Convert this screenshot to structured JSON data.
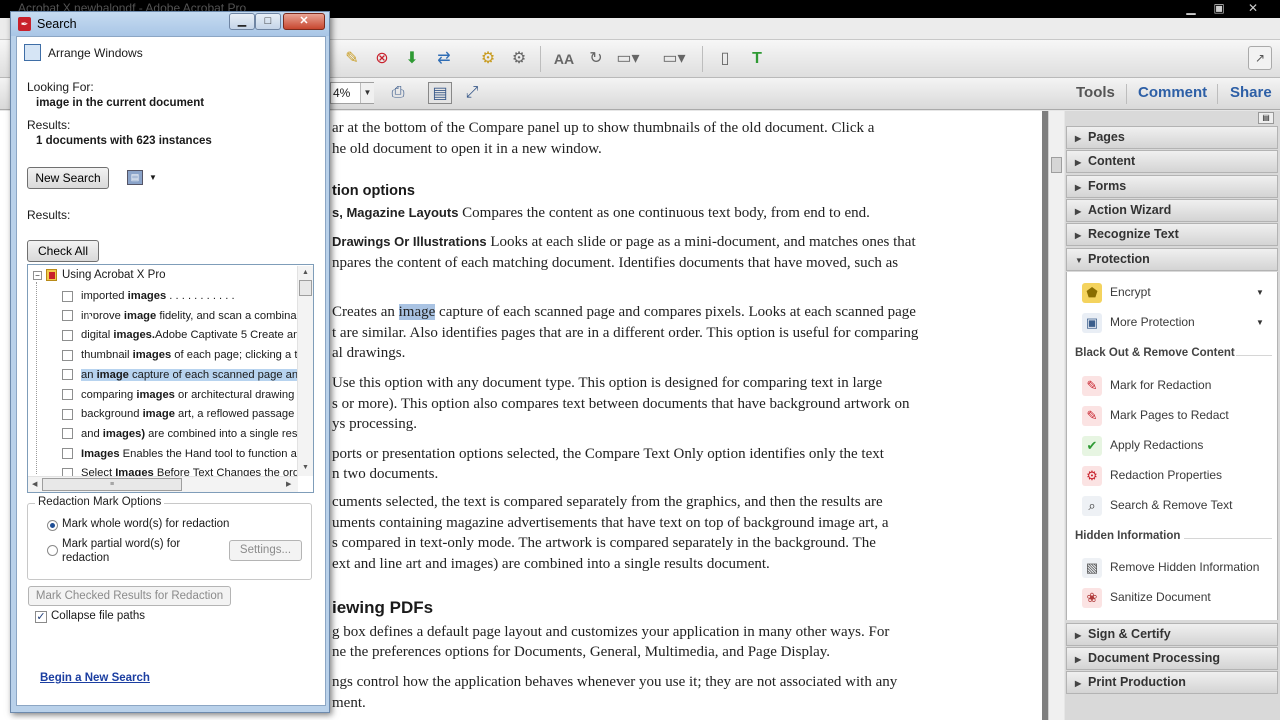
{
  "app": {
    "title": "Acrobat X newbalondf - Adobe Acrobat Pro",
    "zoom_value": "4%",
    "pane_tabs": [
      "Tools",
      "Comment",
      "Share"
    ]
  },
  "toolbar_icons": [
    "edit-icon",
    "delete-page-icon",
    "insert-page-icon",
    "extract-page-icon",
    "replace-page-icon",
    "settings-icon",
    "typeface-icon",
    "rotate-icon",
    "form-icon",
    "layout-icon",
    "page-icon",
    "text-icon"
  ],
  "document": {
    "lines": [
      {
        "text": "ar at the bottom of the Compare panel up to show thumbnails of the old document. Click a"
      },
      {
        "text": "he old document to open it in a new window."
      },
      {
        "heading": "tion options"
      },
      {
        "bold": "s, Magazine Layouts",
        "text": "  Compares the content as one continuous text body, from end to end."
      },
      {
        "bold": "Drawings Or Illustrations",
        "text": "  Looks at each slide or page as a mini-document, and matches ones that"
      },
      {
        "text": "npares the content of each matching document. Identifies documents that have moved, such as"
      },
      {
        "pre": "Creates an ",
        "hl": "image",
        "post": " capture of each scanned page and compares pixels. Looks at each scanned page"
      },
      {
        "text": "t are similar. Also identifies pages that are in a different order. This option is useful for comparing"
      },
      {
        "text": "al drawings."
      },
      {
        "text": "Use this option with any document type. This option is designed for comparing text in large"
      },
      {
        "text": "s or more). This option also compares text between documents that have background artwork on"
      },
      {
        "text": "ys processing."
      },
      {
        "text": "ports or presentation options selected, the Compare Text Only option identifies only the text"
      },
      {
        "text": "n two documents."
      },
      {
        "text": "cuments selected, the text is compared separately from the graphics, and then the results are"
      },
      {
        "text": "uments containing magazine advertisements that have text on top of background image art, a"
      },
      {
        "text": "s compared in text-only mode. The artwork is compared separately in the background. The"
      },
      {
        "text": "ext and line art and images) are combined into a single results document."
      },
      {
        "heading": "iewing PDFs"
      },
      {
        "text": "g box defines a default page layout and customizes your application in many other ways. For"
      },
      {
        "text": "ne the preferences options for Documents, General, Multimedia, and Page Display."
      },
      {
        "text": "ngs control how the application behaves whenever you use it; they are not associated with any"
      },
      {
        "text": "ment."
      }
    ]
  },
  "right_pane": {
    "sections_top": [
      "Pages",
      "Content",
      "Forms",
      "Action Wizard",
      "Recognize Text"
    ],
    "protection": {
      "title": "Protection",
      "items_top": [
        {
          "label": "Encrypt",
          "icon": "encrypt-icon"
        },
        {
          "label": "More Protection",
          "icon": "more-protection-icon"
        }
      ],
      "blackout_title": "Black Out & Remove Content",
      "blackout_items": [
        {
          "label": "Mark for Redaction",
          "icon": "mark-redaction-icon"
        },
        {
          "label": "Mark Pages to Redact",
          "icon": "mark-pages-icon"
        },
        {
          "label": "Apply Redactions",
          "icon": "apply-redactions-icon"
        },
        {
          "label": "Redaction Properties",
          "icon": "redaction-properties-icon"
        },
        {
          "label": "Search & Remove Text",
          "icon": "search-remove-icon"
        }
      ],
      "hidden_title": "Hidden Information",
      "hidden_items": [
        {
          "label": "Remove Hidden Information",
          "icon": "remove-hidden-icon"
        },
        {
          "label": "Sanitize Document",
          "icon": "sanitize-icon"
        }
      ]
    },
    "sections_bottom": [
      "Sign & Certify",
      "Document Processing",
      "Print Production"
    ]
  },
  "search": {
    "window_title": "Search",
    "arrange_label": "Arrange Windows",
    "looking_for_label": "Looking For:",
    "looking_for_value": "image in the current document",
    "results_label": "Results:",
    "results_value": "1 documents with 623 instances",
    "new_search_label": "New Search",
    "results_label_2": "Results:",
    "check_all_label": "Check All",
    "tree_root": "Using Acrobat X Pro",
    "results": [
      {
        "pre": "imported ",
        "b": "images",
        "post": " . . . . . . . . . . ."
      },
      {
        "pre": "improve ",
        "b": "image",
        "post": " fidelity, and scan a combina"
      },
      {
        "pre": "digital ",
        "b": "images.",
        "post": "Adobe Captivate 5 Create an"
      },
      {
        "pre": "thumbnail ",
        "b": "images",
        "post": " of each page; clicking a t"
      },
      {
        "pre": "an ",
        "b": "image",
        "post": " capture of each scanned page and"
      },
      {
        "pre": "comparing ",
        "b": "images",
        "post": " or architectural drawing"
      },
      {
        "pre": "background ",
        "b": "image",
        "post": " art, a reflowed passage i"
      },
      {
        "pre": "and ",
        "b": "images)",
        "post": " are combined into a single resu"
      },
      {
        "pre": "",
        "b": "Images",
        "post": " Enables the Hand tool to function a"
      },
      {
        "pre": "Select ",
        "b": "Images",
        "post": " Before Text Changes the orde"
      }
    ],
    "selected_index": 4,
    "redaction_group_label": "Redaction Mark Options",
    "radio_whole": "Mark whole word(s) for redaction",
    "radio_partial_1": "Mark partial word(s) for",
    "radio_partial_2": "redaction",
    "settings_label": "Settings...",
    "mark_checked_label": "Mark Checked Results for Redaction",
    "collapse_label": "Collapse file paths",
    "begin_new_label": "Begin a New Search"
  }
}
